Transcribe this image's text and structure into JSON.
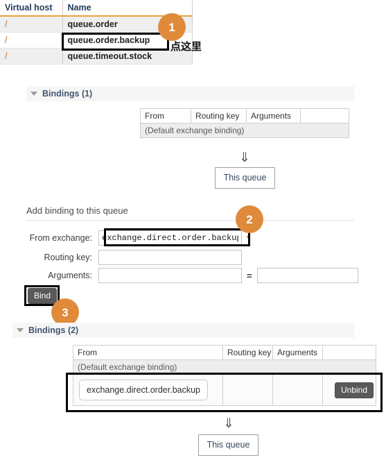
{
  "queues_table": {
    "name": "queues-list",
    "headers": [
      "Virtual host",
      "Name"
    ],
    "rows": [
      {
        "vhost": "/",
        "name": "queue.order"
      },
      {
        "vhost": "/",
        "name": "queue.order.backup"
      },
      {
        "vhost": "/",
        "name": "queue.timeout.stock"
      }
    ]
  },
  "annotations": {
    "badge1": "1",
    "badge2": "2",
    "badge3": "3",
    "note_cn": "点这里",
    "badge_color": "#e08a3c",
    "highlight_color": "#000000"
  },
  "bindings_before": {
    "title": "Bindings (1)",
    "headers": [
      "From",
      "Routing key",
      "Arguments",
      ""
    ],
    "default_row": "(Default exchange binding)",
    "arrow": "⇓",
    "queue_box": "This queue"
  },
  "add_binding": {
    "title": "Add binding to this queue",
    "from_exchange_label": "From exchange:",
    "from_exchange_value": "exchange.direct.order.backup",
    "from_exchange_placeholder": "",
    "required_mark": "*",
    "routing_key_label": "Routing key:",
    "routing_key_value": "",
    "routing_key_placeholder": "",
    "arguments_label": "Arguments:",
    "argument_key_value": "",
    "argument_key_placeholder": "",
    "equals": "=",
    "argument_value_value": "",
    "argument_value_placeholder": "",
    "bind_button": "Bind"
  },
  "bindings_after": {
    "title": "Bindings (2)",
    "headers": [
      "From",
      "Routing key",
      "Arguments",
      ""
    ],
    "default_row": "(Default exchange binding)",
    "binding_from": "exchange.direct.order.backup",
    "binding_routing_key": "",
    "binding_arguments": "",
    "unbind_button": "Unbind",
    "arrow": "⇓",
    "queue_box": "This queue"
  }
}
